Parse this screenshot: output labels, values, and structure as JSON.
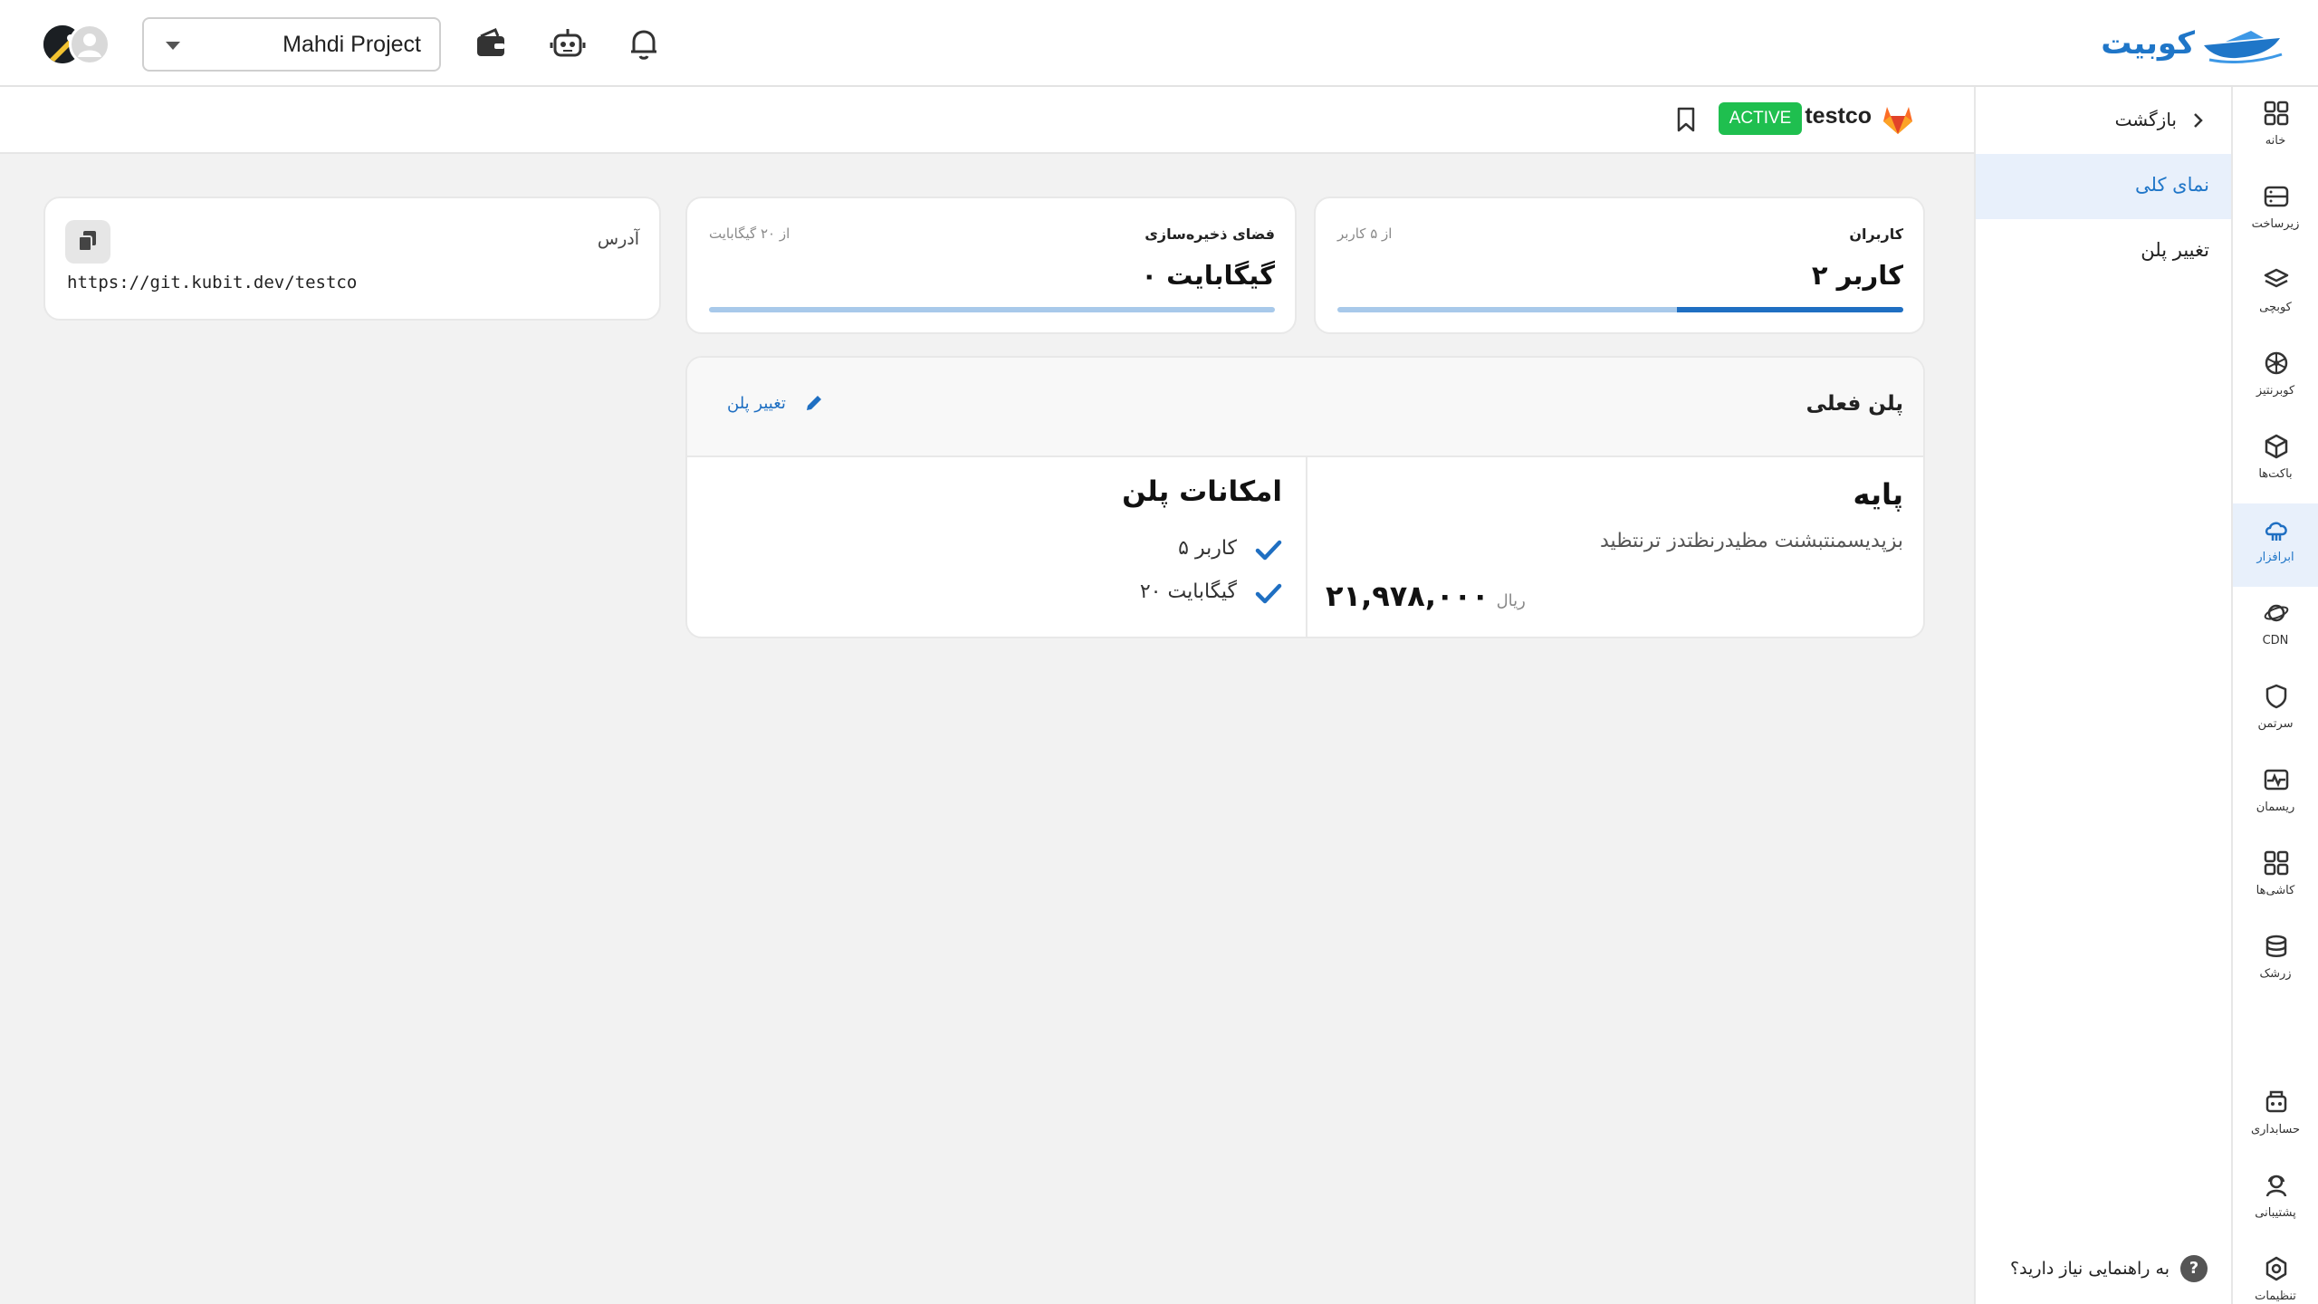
{
  "header": {
    "brand": "کوبیت",
    "project": "Mahdi Project",
    "icons": [
      "wallet-icon",
      "robot-icon",
      "bell-icon"
    ]
  },
  "rail": {
    "items": [
      {
        "label": "خانه",
        "icon": "grid-icon"
      },
      {
        "label": "زیرساخت",
        "icon": "server-icon"
      },
      {
        "label": "کوبچی",
        "icon": "layers-icon"
      },
      {
        "label": "کوبرنتیز",
        "icon": "kubernetes-icon"
      },
      {
        "label": "باکت‌ها",
        "icon": "box-icon"
      },
      {
        "label": "ابرافزار",
        "icon": "cloud-app-icon"
      },
      {
        "label": "CDN",
        "icon": "planet-icon"
      },
      {
        "label": "سرتمن",
        "icon": "shield-icon"
      },
      {
        "label": "ریسمان",
        "icon": "pulse-icon"
      },
      {
        "label": "کاشی‌ها",
        "icon": "tiles-icon"
      },
      {
        "label": "زرشک",
        "icon": "database-icon"
      },
      {
        "label": "حسابداری",
        "icon": "calculator-icon"
      },
      {
        "label": "پشتیبانی",
        "icon": "support-icon"
      },
      {
        "label": "تنظیمات",
        "icon": "settings-icon"
      }
    ],
    "active_index": 5
  },
  "sidebar": {
    "back": "بازگشت",
    "items": [
      "نمای کلی",
      "تغییر پلن"
    ],
    "help": "به راهنمایی نیاز دارید؟"
  },
  "repo": {
    "name": "testco",
    "status": "ACTIVE"
  },
  "cards": {
    "users": {
      "title": "کاربران",
      "value": "۲ کاربر",
      "limit": "از ۵ کاربر",
      "used_fraction": 0.4
    },
    "storage": {
      "title": "فضای ذخیره‌سازی",
      "value": "۰ گیگابایت",
      "limit": "از ۲۰ گیگابایت",
      "used_fraction": 0
    },
    "address": {
      "label": "آدرس",
      "value": "https://git.kubit.dev/testco"
    }
  },
  "plan": {
    "heading": "پلن فعلی",
    "change": "تغییر پلن",
    "name": "پایه",
    "description": "بزپدیسمنتبشنت مظیدرنظتدز ترنتظید",
    "price": "۲۱,۹۷۸,۰۰۰",
    "currency": "ریال",
    "features_title": "امکانات پلن",
    "features": [
      "۵ کاربر",
      "۲۰ گیگابایت"
    ]
  },
  "colors": {
    "accent": "#1f6fc2",
    "active_badge": "#1fbf4f",
    "gitlab": "#e24329"
  }
}
